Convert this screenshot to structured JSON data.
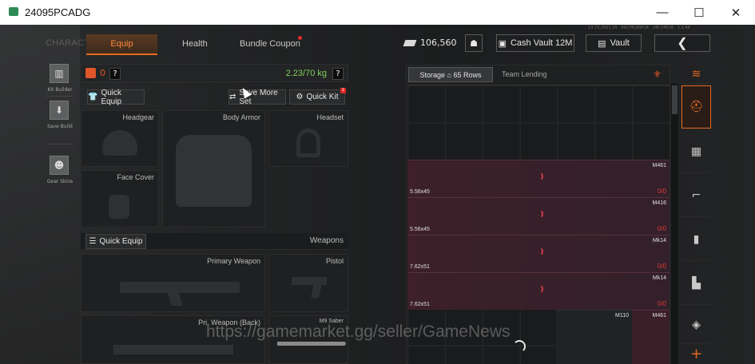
{
  "window": {
    "title": "24095PCADG",
    "minimize": "—",
    "maximize": "☐",
    "close": "✕"
  },
  "nav": {
    "character": "CHARACTER",
    "equip": "Equip",
    "health": "Health",
    "bundle": "Bundle Coupon"
  },
  "topbar": {
    "money": "106,560",
    "cash_vault": "Cash Vault 12M",
    "vault": "Vault",
    "back": "❮",
    "info_text": "13.73.2501.15 · 8427B189F2E · 28C3461B · 1.1.44"
  },
  "left_menu": {
    "kit_builder": "Kit Builder",
    "save_build": "Save Build",
    "gear_skins": "Gear Skins"
  },
  "weight": {
    "bag_count": "0",
    "help": "?",
    "value": "2.23/70 kg",
    "help2": "?"
  },
  "actions": {
    "quick_equip": "Quick Equip",
    "save_more_set": "Save More Set",
    "quick_kit": "Quick Kit",
    "quick_kit_badge": "1"
  },
  "slots": {
    "headgear": "Headgear",
    "body_armor": "Body Armor",
    "headset": "Headset",
    "face_cover": "Face Cover"
  },
  "weapons_bar": {
    "quick_equip": "Quick Equip",
    "label": "Weapons"
  },
  "weapon_slots": {
    "primary": "Primary Weapon",
    "pistol": "Pistol",
    "pri_back": "Pri. Weapon (Back)",
    "melee": "M9 Saber"
  },
  "storage": {
    "tab_storage": "Storage",
    "rows": "65 Rows",
    "tab_lending": "Team Lending",
    "ammo": [
      {
        "caliber": "5.56x45",
        "name": "M461",
        "count": "0/0"
      },
      {
        "caliber": "5.56x45",
        "name": "M416",
        "count": "0/0"
      },
      {
        "caliber": "7.62x51",
        "name": "Mk14",
        "count": "0/0"
      },
      {
        "caliber": "7.62x51",
        "name": "Mk14",
        "count": "0/0"
      }
    ],
    "bottom_labels": {
      "m110": "M110",
      "m461": "M461"
    }
  },
  "watermark": "https://gamemarket.gg/seller/GameNews",
  "colors": {
    "accent": "#e56a1f",
    "weight_green": "#7fd15a",
    "ammo_bg": "#3a1e28",
    "alert_red": "#e02a2a"
  }
}
